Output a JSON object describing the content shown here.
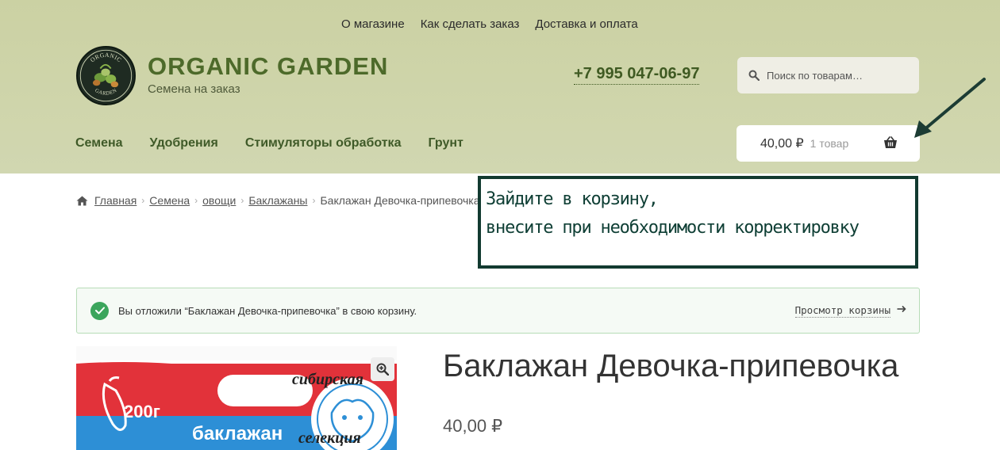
{
  "topnav": {
    "items": [
      {
        "label": "О магазине"
      },
      {
        "label": "Как сделать заказ"
      },
      {
        "label": "Доставка и оплата"
      }
    ]
  },
  "brand": {
    "title": "ORGANIC GARDEN",
    "tagline": "Семена на заказ",
    "logo_top": "ORGANIC",
    "logo_bottom": "GARDEN",
    "color": "#4d6a2a"
  },
  "phone": "+7 995 047-06-97",
  "search": {
    "placeholder": "Поиск по товарам…",
    "icon": "search-icon"
  },
  "mainnav": {
    "items": [
      {
        "label": "Семена"
      },
      {
        "label": "Удобрения"
      },
      {
        "label": "Стимуляторы обработка"
      },
      {
        "label": "Грунт"
      }
    ]
  },
  "cart": {
    "amount": "40,00 ₽",
    "count": "1 товар",
    "icon": "basket-icon"
  },
  "breadcrumb": {
    "items": [
      {
        "label": "Главная"
      },
      {
        "label": "Семена"
      },
      {
        "label": "овощи"
      },
      {
        "label": "Баклажаны"
      }
    ],
    "current": "Баклажан Девочка-припевочка"
  },
  "callout": {
    "line1": "Зайдите в корзину,",
    "line2": "внесите при необходимости корректировку"
  },
  "notice": {
    "message": "Вы отложили “Баклажан Девочка-припевочка” в свою корзину.",
    "view_cart": "Просмотр корзины",
    "color": "#3ba55c"
  },
  "product": {
    "title": "Баклажан Девочка-припевочка",
    "price": "40,00 ₽",
    "image": {
      "weight": "200г",
      "brand": "сибирская",
      "name": "баклажан",
      "label": "селекция"
    }
  }
}
